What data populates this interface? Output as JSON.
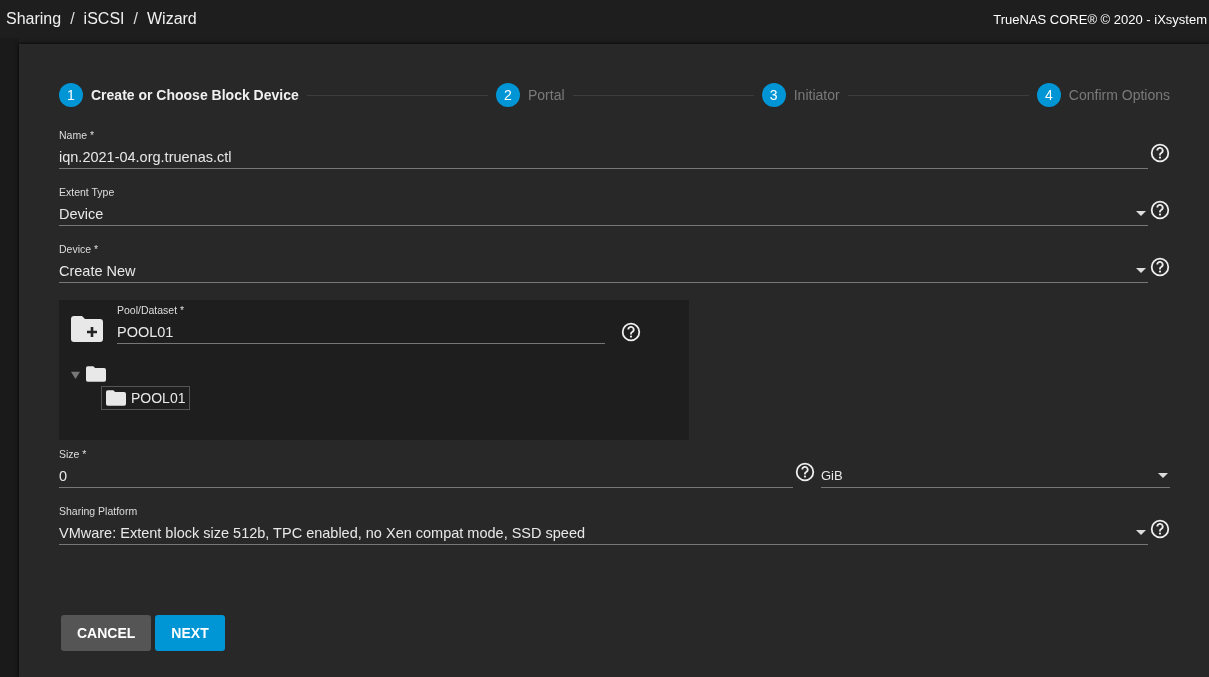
{
  "breadcrumb": [
    "Sharing",
    "iSCSI",
    "Wizard"
  ],
  "breadcrumb_separator": "/",
  "copyright": "TrueNAS CORE® © 2020 - iXsystem",
  "steps": [
    {
      "number": "1",
      "label": "Create or Choose Block Device",
      "selected": true
    },
    {
      "number": "2",
      "label": "Portal",
      "selected": false
    },
    {
      "number": "3",
      "label": "Initiator",
      "selected": false
    },
    {
      "number": "4",
      "label": "Confirm Options",
      "selected": false
    }
  ],
  "fields": [
    {
      "kind": "input",
      "label": "Name *",
      "value": "iqn.2021-04.org.truenas.ctl"
    },
    {
      "kind": "select",
      "label": "Extent Type",
      "value": "Device"
    },
    {
      "kind": "select",
      "label": "Device *",
      "value": "Create New"
    }
  ],
  "pool_dataset": {
    "label": "Pool/Dataset *",
    "value": "POOL01",
    "tree": {
      "expanded": true,
      "children": [
        {
          "label": "POOL01",
          "selected": true
        }
      ]
    }
  },
  "size": {
    "label": "Size *",
    "value": "0",
    "unit": "GiB"
  },
  "sharing_platform": {
    "kind": "select",
    "label": "Sharing Platform",
    "value": "VMware: Extent block size 512b, TPC enabled, no Xen compat mode, SSD speed"
  },
  "buttons": [
    {
      "kind": "secondary",
      "label": "CANCEL"
    },
    {
      "kind": "primary",
      "label": "NEXT"
    }
  ]
}
